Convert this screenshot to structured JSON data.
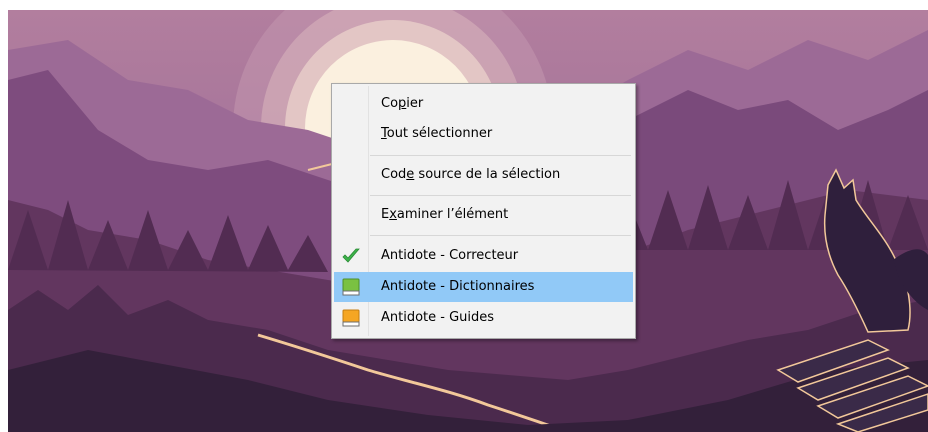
{
  "context_menu": {
    "items": [
      {
        "label": "Copier",
        "mnemonic": "p",
        "icon": null,
        "highlighted": false
      },
      {
        "label": "Tout sélectionner",
        "mnemonic": "T",
        "icon": null,
        "highlighted": false
      },
      {
        "label": "Code source de la sélection",
        "mnemonic": "e",
        "icon": null,
        "highlighted": false
      },
      {
        "label": "Examiner l’élément",
        "mnemonic": "x",
        "icon": null,
        "highlighted": false
      },
      {
        "label": "Antidote - Correcteur",
        "mnemonic": null,
        "icon": "green-checkmark-icon",
        "highlighted": false
      },
      {
        "label": "Antidote - Dictionnaires",
        "mnemonic": null,
        "icon": "green-book-icon",
        "highlighted": true
      },
      {
        "label": "Antidote - Guides",
        "mnemonic": null,
        "icon": "orange-book-icon",
        "highlighted": false
      }
    ]
  },
  "background": {
    "description_icon": "mountain-landscape-fox-illustration",
    "colors": {
      "sky": "#a26f9c",
      "sun": "#fbf0df",
      "far_mountains": "#8d5a8c",
      "mid_mountains": "#6b3f6b",
      "near_forest": "#4d2b4f",
      "river": "#f2c89a",
      "fox": "#2f1f3c"
    }
  },
  "colors": {
    "menu_bg": "#f2f2f2",
    "menu_highlight": "#91c9f7",
    "menu_border": "#a9a9a9"
  }
}
